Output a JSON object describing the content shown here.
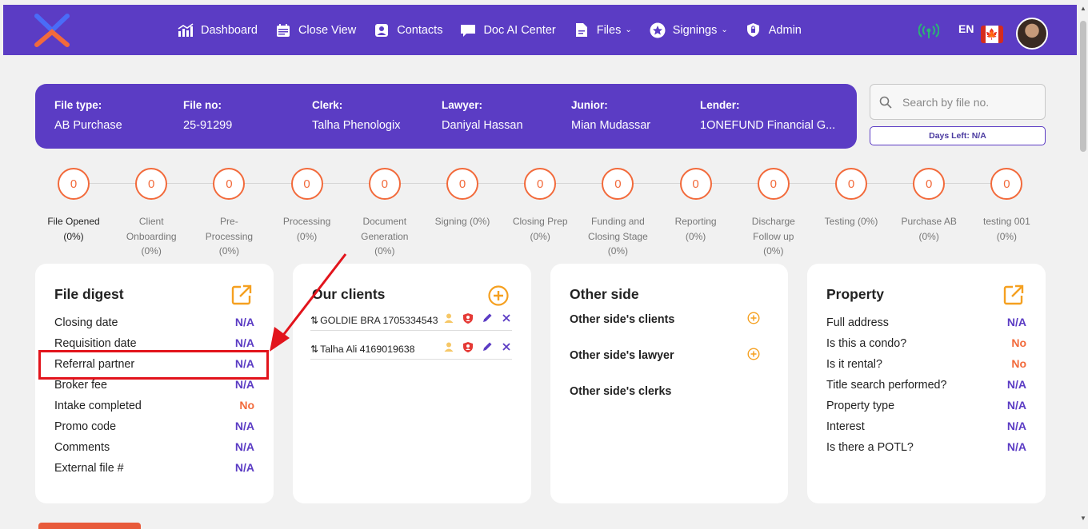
{
  "nav": {
    "items": [
      {
        "label": "Dashboard",
        "icon": "chart-icon",
        "caret": false
      },
      {
        "label": "Close View",
        "icon": "calendar-icon",
        "caret": false
      },
      {
        "label": "Contacts",
        "icon": "contact-icon",
        "caret": false
      },
      {
        "label": "Doc AI Center",
        "icon": "chat-icon",
        "caret": false
      },
      {
        "label": "Files",
        "icon": "file-icon",
        "caret": true
      },
      {
        "label": "Signings",
        "icon": "star-icon",
        "caret": true
      },
      {
        "label": "Admin",
        "icon": "shield-icon",
        "caret": false
      }
    ],
    "language": "EN"
  },
  "file_info": {
    "file_type_label": "File type:",
    "file_type": "AB Purchase",
    "file_no_label": "File no:",
    "file_no": "25-91299",
    "clerk_label": "Clerk:",
    "clerk": "Talha Phenologix",
    "lawyer_label": "Lawyer:",
    "lawyer": "Daniyal Hassan",
    "junior_label": "Junior:",
    "junior": "Mian Mudassar",
    "lender_label": "Lender:",
    "lender": "1ONEFUND Financial G..."
  },
  "search": {
    "placeholder": "Search by file no."
  },
  "days_left": "Days Left: N/A",
  "stages": [
    {
      "count": "0",
      "line1": "File Opened",
      "line2": "(0%)",
      "line3": ""
    },
    {
      "count": "0",
      "line1": "Client",
      "line2": "Onboarding",
      "line3": "(0%)"
    },
    {
      "count": "0",
      "line1": "Pre-",
      "line2": "Processing",
      "line3": "(0%)"
    },
    {
      "count": "0",
      "line1": "Processing",
      "line2": "(0%)",
      "line3": ""
    },
    {
      "count": "0",
      "line1": "Document",
      "line2": "Generation",
      "line3": "(0%)"
    },
    {
      "count": "0",
      "line1": "Signing (0%)",
      "line2": "",
      "line3": ""
    },
    {
      "count": "0",
      "line1": "Closing Prep",
      "line2": "(0%)",
      "line3": ""
    },
    {
      "count": "0",
      "line1": "Funding and",
      "line2": "Closing Stage",
      "line3": "(0%)"
    },
    {
      "count": "0",
      "line1": "Reporting",
      "line2": "(0%)",
      "line3": ""
    },
    {
      "count": "0",
      "line1": "Discharge",
      "line2": "Follow up",
      "line3": "(0%)"
    },
    {
      "count": "0",
      "line1": "Testing (0%)",
      "line2": "",
      "line3": ""
    },
    {
      "count": "0",
      "line1": "Purchase AB",
      "line2": "(0%)",
      "line3": ""
    },
    {
      "count": "0",
      "line1": "testing 001",
      "line2": "(0%)",
      "line3": ""
    }
  ],
  "file_digest": {
    "title": "File digest",
    "rows": [
      {
        "label": "Closing date",
        "value": "N/A"
      },
      {
        "label": "Requisition date",
        "value": "N/A"
      },
      {
        "label": "Referral partner",
        "value": "N/A"
      },
      {
        "label": "Broker fee",
        "value": "N/A"
      },
      {
        "label": "Intake completed",
        "value": "No"
      },
      {
        "label": "Promo code",
        "value": "N/A"
      },
      {
        "label": "Comments",
        "value": "N/A"
      },
      {
        "label": "External file #",
        "value": "N/A"
      }
    ]
  },
  "our_clients": {
    "title": "Our clients",
    "clients": [
      {
        "name": "GOLDIE BRA 1705334543"
      },
      {
        "name": "Talha Ali 4169019638"
      }
    ]
  },
  "other_side": {
    "title": "Other side",
    "clients_label": "Other side's clients",
    "lawyer_label": "Other side's lawyer",
    "clerks_label": "Other side's clerks"
  },
  "property": {
    "title": "Property",
    "rows": [
      {
        "label": "Full address",
        "value": "N/A"
      },
      {
        "label": "Is this a condo?",
        "value": "No"
      },
      {
        "label": "Is it rental?",
        "value": "No"
      },
      {
        "label": "Title search performed?",
        "value": "N/A"
      },
      {
        "label": "Property type",
        "value": "N/A"
      },
      {
        "label": "Interest",
        "value": "N/A"
      },
      {
        "label": "Is there a POTL?",
        "value": "N/A"
      }
    ]
  },
  "colors": {
    "brand": "#5b3cc4",
    "accent": "#f26a3b",
    "annotation": "#e2141c"
  }
}
